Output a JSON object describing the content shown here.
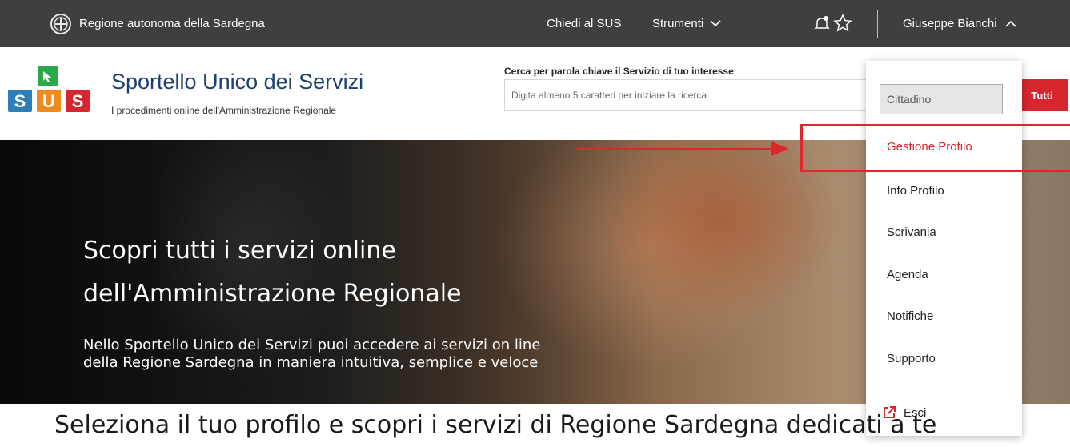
{
  "topbar": {
    "region_name": "Regione autonoma della Sardegna",
    "chiedi": "Chiedi al SUS",
    "strumenti": "Strumenti",
    "user_name": "Giuseppe Bianchi"
  },
  "header": {
    "logo_letters": [
      "S",
      "U",
      "S"
    ],
    "title": "Sportello Unico dei Servizi",
    "subtitle": "I procedimenti online dell'Amministrazione Regionale"
  },
  "search": {
    "label": "Cerca per parola chiave il Servizio di tuo interesse",
    "placeholder": "Digita almeno 5 caratteri per iniziare la ricerca",
    "button": "Tutti"
  },
  "hero": {
    "title": "Scopri tutti i servizi online dell'Amministrazione Regionale",
    "text_line1": "Nello Sportello Unico dei Servizi puoi accedere ai servizi on line",
    "text_line2": "della Regione Sardegna in maniera intuitiva, semplice e veloce"
  },
  "dropdown": {
    "role": "Cittadino",
    "items": [
      {
        "label": "Gestione Profilo",
        "active": true
      },
      {
        "label": "Info Profilo"
      },
      {
        "label": "Scrivania"
      },
      {
        "label": "Agenda"
      },
      {
        "label": "Notifiche"
      },
      {
        "label": "Supporto"
      }
    ],
    "logout": "Esci"
  },
  "section": {
    "title": "Seleziona il tuo profilo e scopri i servizi di Regione Sardegna dedicati a te"
  },
  "colors": {
    "topbar_bg": "#3f3f3f",
    "accent_red": "#d6272e",
    "title_blue": "#1d3f6e",
    "logo_green": "#2aa84a",
    "logo_blue": "#2c7fb8",
    "logo_orange": "#f08a1c",
    "logo_red": "#d6272e"
  }
}
